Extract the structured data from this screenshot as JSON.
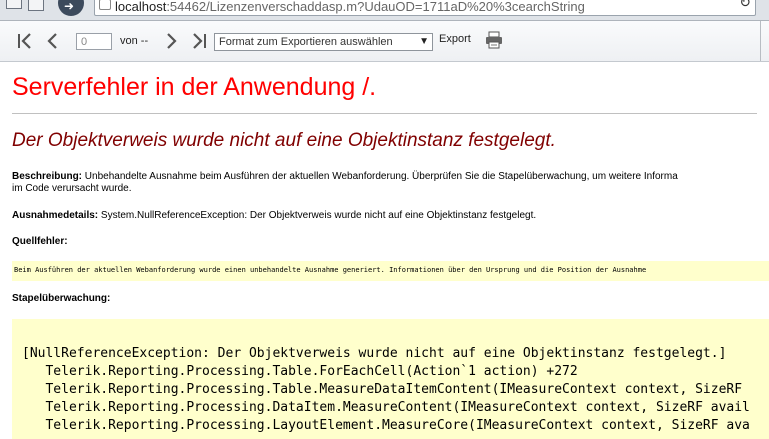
{
  "browser": {
    "url_host": "localhost",
    "url_rest": ":54462/Lizenzenverschaddasp.m?UdauOD=1711aD%20%3cearchString"
  },
  "toolbar": {
    "page_value": "0",
    "of_label": "von --",
    "format_placeholder": "Format zum Exportieren auswählen",
    "export_label": "Export"
  },
  "error_page": {
    "title": "Serverfehler in der Anwendung /.",
    "subtitle": "Der Objektverweis wurde nicht auf eine Objektinstanz festgelegt.",
    "description_label": "Beschreibung:",
    "description_line1": "Unbehandelte Ausnahme beim Ausführen der aktuellen Webanforderung. Überprüfen Sie die Stapelüberwachung, um weitere Informa",
    "description_line2": "im Code verursacht wurde.",
    "exception_label": "Ausnahmedetails:",
    "exception_text": "System.NullReferenceException: Der Objektverweis wurde nicht auf eine Objektinstanz festgelegt.",
    "source_error_label": "Quellfehler:",
    "source_error_text": "Beim Ausführen der aktuellen Webanforderung wurde einen unbehandelte Ausnahme generiert. Informationen über den Ursprung und die Position der Ausnahme",
    "stack_trace_label": "Stapelüberwachung:",
    "stack_lines": [
      "[NullReferenceException: Der Objektverweis wurde nicht auf eine Objektinstanz festgelegt.]",
      "   Telerik.Reporting.Processing.Table.ForEachCell(Action`1 action) +272",
      "   Telerik.Reporting.Processing.Table.MeasureDataItemContent(IMeasureContext context, SizeRF",
      "   Telerik.Reporting.Processing.DataItem.MeasureContent(IMeasureContext context, SizeRF avail",
      "   Telerik.Reporting.Processing.LayoutElement.MeasureCore(IMeasureContext context, SizeRF ava"
    ]
  },
  "colors": {
    "title_red": "#ff0000",
    "subtitle_maroon": "#800000",
    "code_background": "#ffffcc"
  },
  "icons": [
    "first-page-icon",
    "previous-page-icon",
    "next-page-icon",
    "last-page-icon",
    "print-icon",
    "dropdown-arrow-icon",
    "refresh-icon"
  ]
}
